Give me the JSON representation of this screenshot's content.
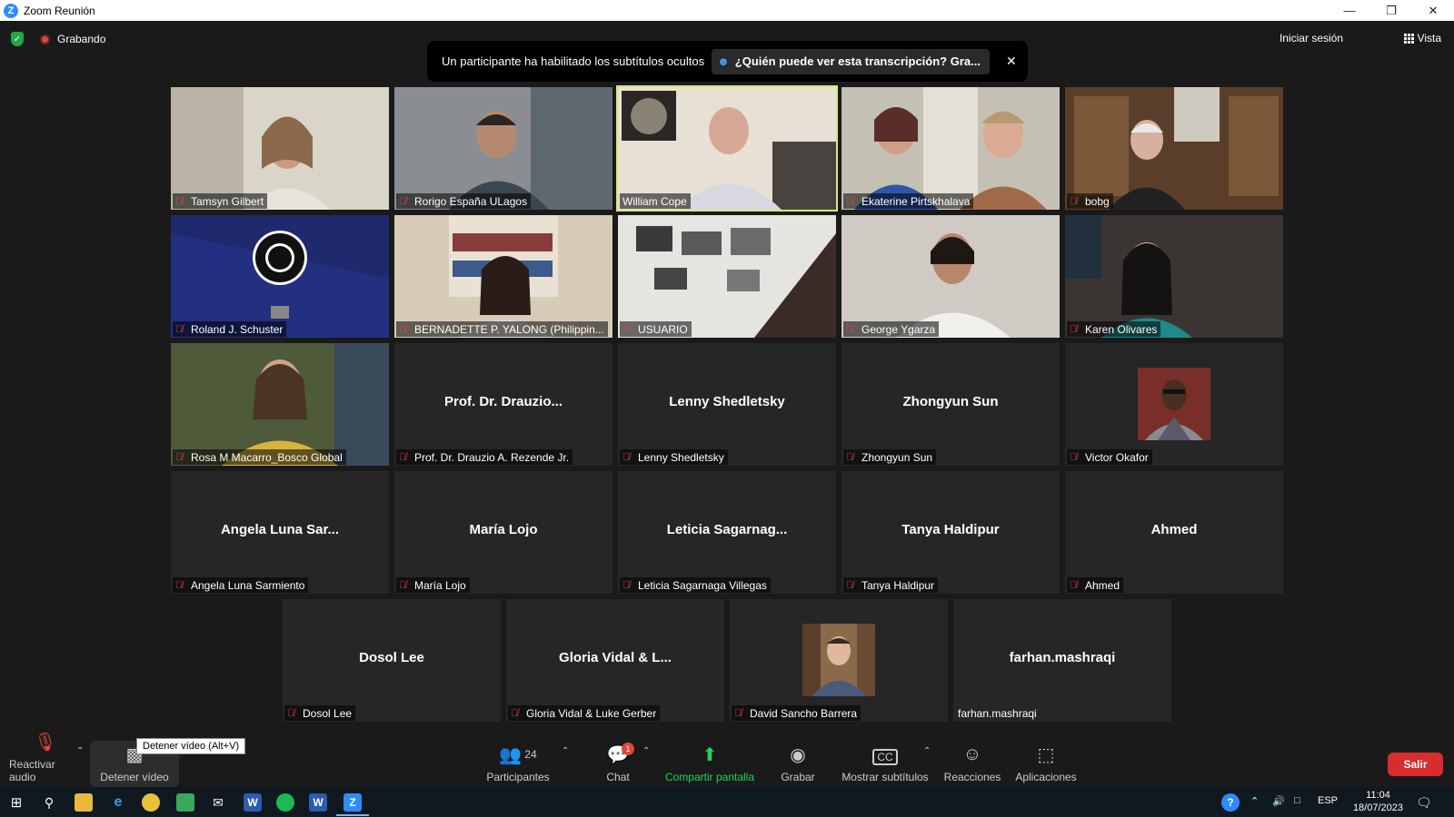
{
  "window": {
    "title": "Zoom Reunión"
  },
  "topbar": {
    "recording_label": "Grabando",
    "signin_label": "Iniciar sesión",
    "view_label": "Vista"
  },
  "banner": {
    "message": "Un participante ha habilitado los subtítulos ocultos",
    "link": "¿Quién puede ver esta transcripción? Gra...",
    "close": "✕"
  },
  "participants": [
    {
      "label": "Tamsyn Gilbert",
      "big": ""
    },
    {
      "label": "Rorigo España ULagos",
      "big": ""
    },
    {
      "label": "William Cope",
      "big": ""
    },
    {
      "label": "Ekaterine Pirtskhalava",
      "big": ""
    },
    {
      "label": "bobg",
      "big": ""
    },
    {
      "label": "Roland J. Schuster",
      "big": ""
    },
    {
      "label": "BERNADETTE P. YALONG (Philippin...",
      "big": ""
    },
    {
      "label": "USUARIO",
      "big": ""
    },
    {
      "label": "George Ygarza",
      "big": ""
    },
    {
      "label": "Karen Olivares",
      "big": ""
    },
    {
      "label": "Rosa M Macarro_Bosco Global",
      "big": ""
    },
    {
      "label": "Prof. Dr. Drauzio A. Rezende Jr.",
      "big": "Prof. Dr. Drauzio..."
    },
    {
      "label": "Lenny Shedletsky",
      "big": "Lenny Shedletsky"
    },
    {
      "label": "Zhongyun Sun",
      "big": "Zhongyun Sun"
    },
    {
      "label": "Victor Okafor",
      "big": ""
    },
    {
      "label": "Angela Luna Sarmiento",
      "big": "Angela Luna Sar..."
    },
    {
      "label": "María Lojo",
      "big": "María Lojo"
    },
    {
      "label": "Leticia Sagarnaga Villegas",
      "big": "Leticia Sagarnag..."
    },
    {
      "label": "Tanya Haldipur",
      "big": "Tanya Haldipur"
    },
    {
      "label": "Ahmed",
      "big": "Ahmed"
    },
    {
      "label": "Dosol Lee",
      "big": "Dosol Lee"
    },
    {
      "label": "Gloria Vidal & Luke Gerber",
      "big": "Gloria Vidal & L..."
    },
    {
      "label": "David Sancho Barrera",
      "big": ""
    },
    {
      "label": "farhan.mashraqi",
      "big": "farhan.mashraqi"
    }
  ],
  "toolbar": {
    "unmute": "Reactivar audio",
    "stop_video": "Detener vídeo",
    "tooltip": "Detener vídeo (Alt+V)",
    "participants": "Participantes",
    "participants_count": "24",
    "chat": "Chat",
    "chat_badge": "1",
    "share": "Compartir pantalla",
    "record": "Grabar",
    "captions": "Mostrar subtítulos",
    "reactions": "Reacciones",
    "apps": "Aplicaciones",
    "leave": "Salir"
  },
  "taskbar": {
    "lang": "ESP",
    "time": "11:04",
    "date": "18/07/2023"
  },
  "colors": {
    "accent_green": "#23d160",
    "leave_red": "#d92c2c",
    "active_speaker": "#d6e87a",
    "zoom_blue": "#2d8cff"
  }
}
